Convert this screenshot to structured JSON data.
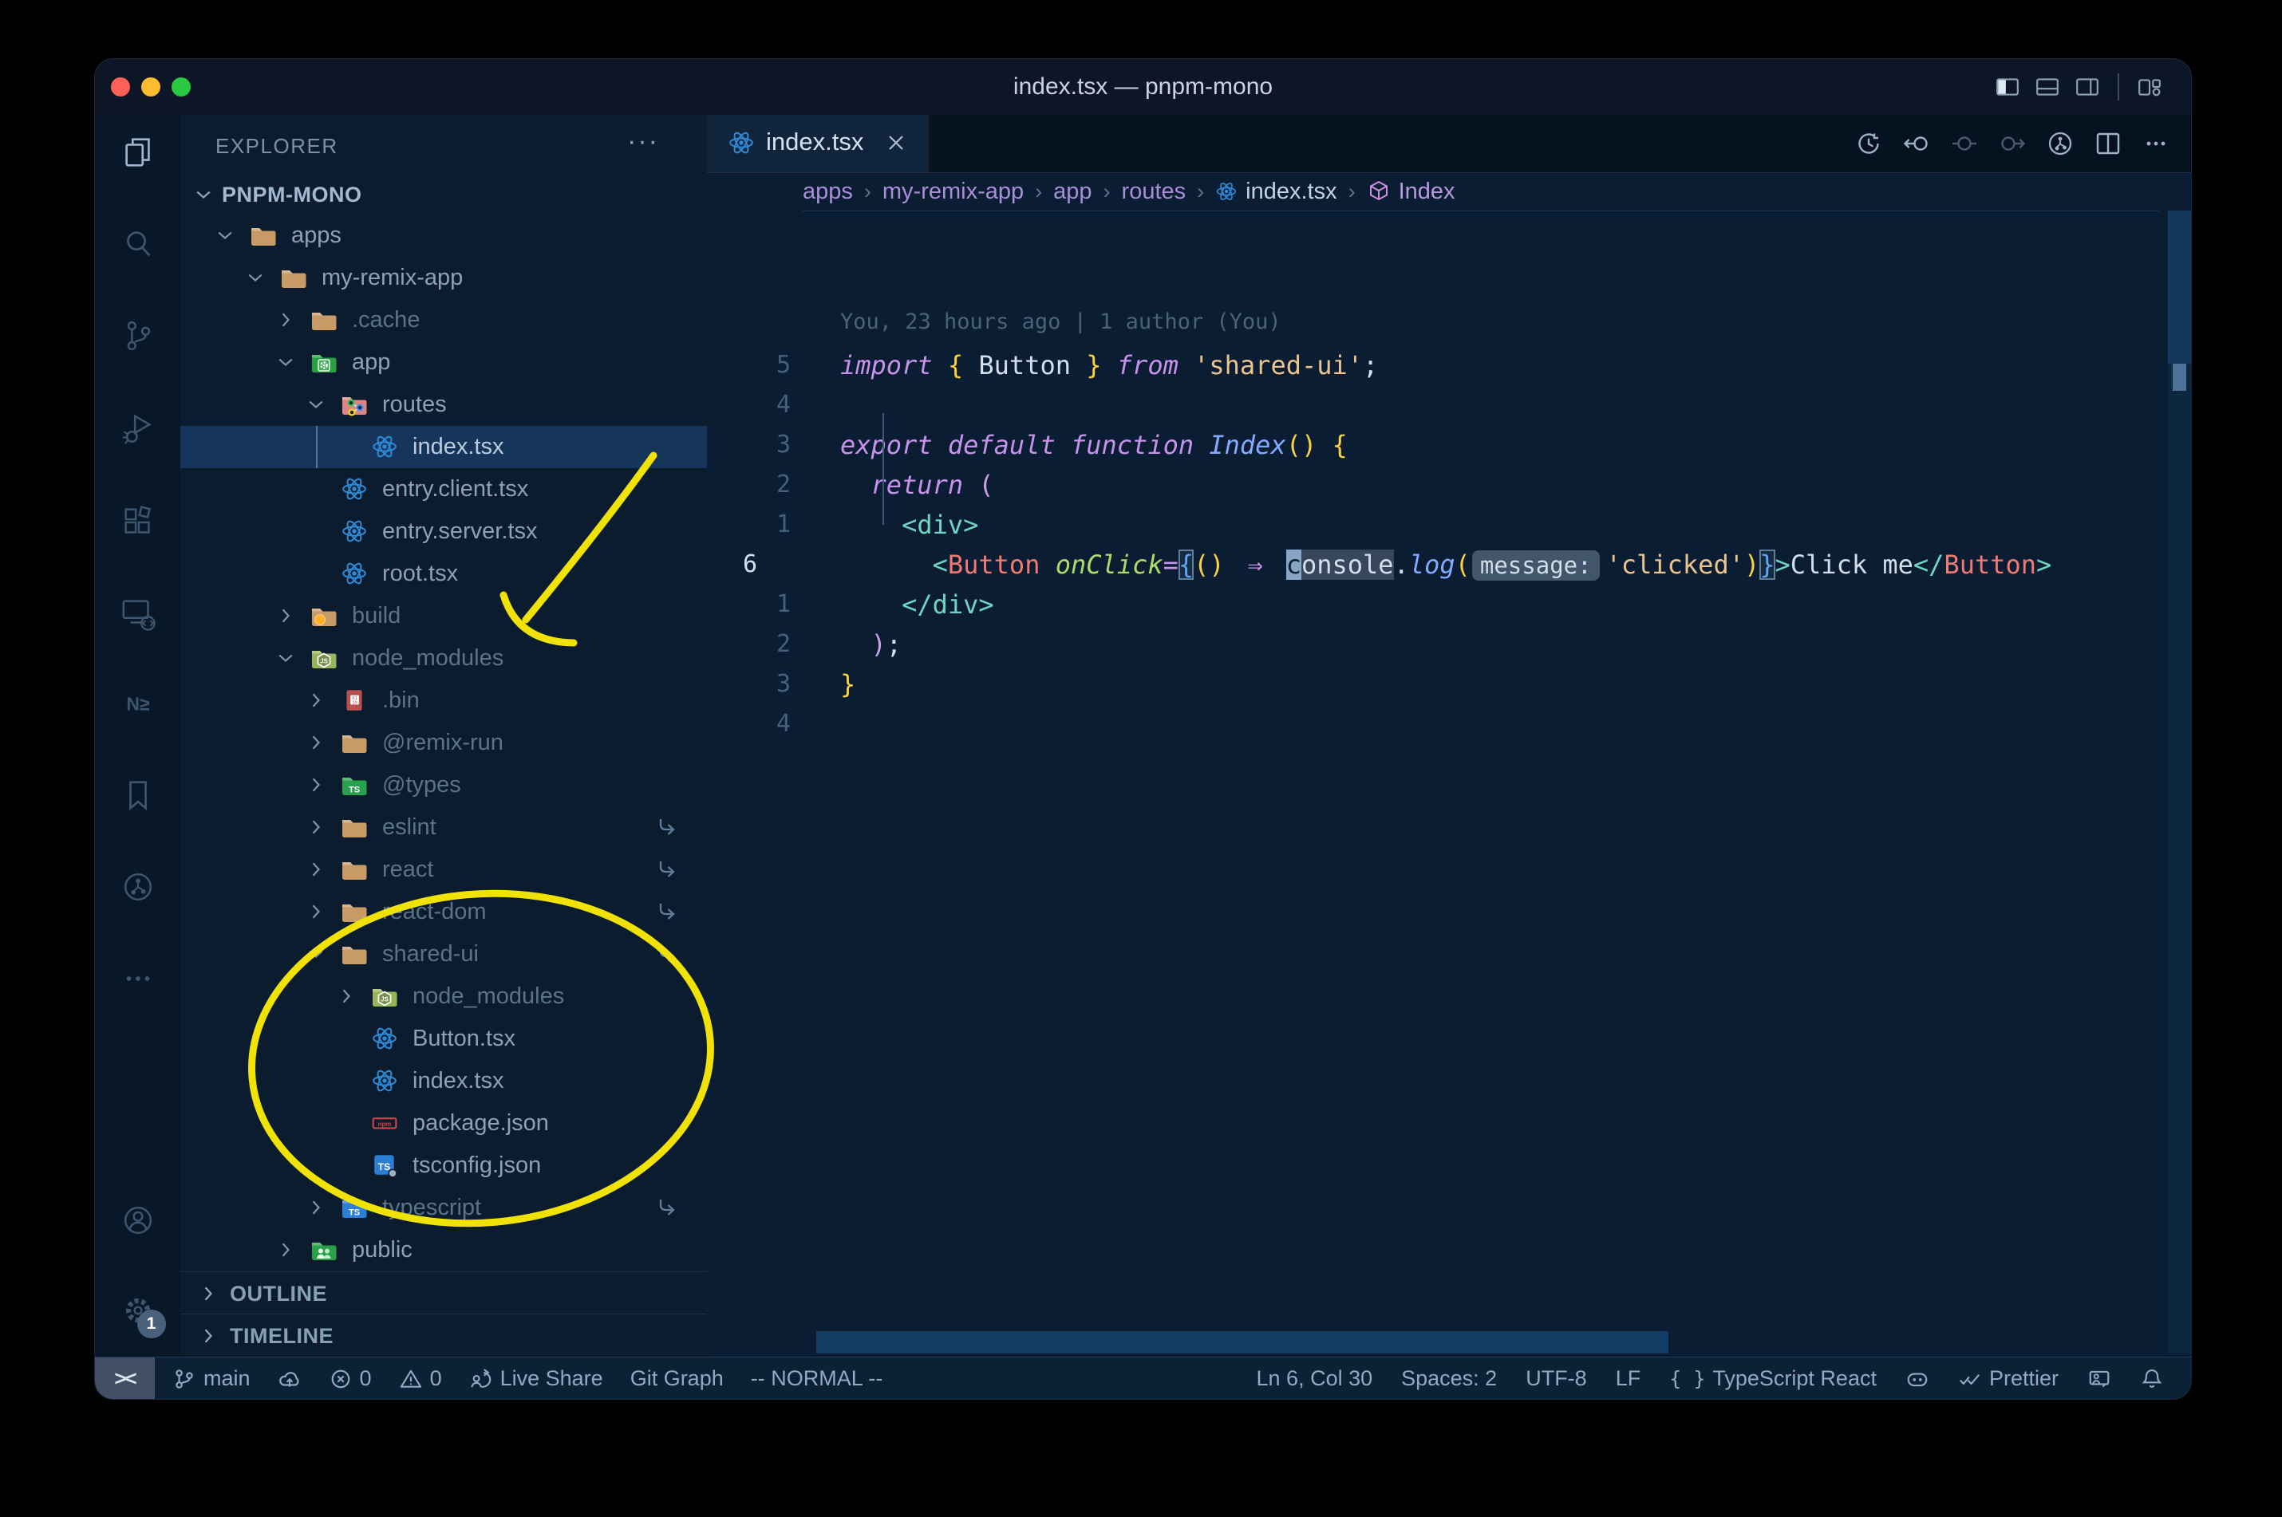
{
  "window": {
    "title": "index.tsx — pnpm-mono"
  },
  "colors": {
    "accent": "#2d8ad6",
    "selection": "#16355a",
    "annotation": "#f0e204"
  },
  "titlebar_actions": [
    {
      "id": "toggle-primary-sidebar"
    },
    {
      "id": "toggle-panel"
    },
    {
      "id": "toggle-secondary-sidebar"
    },
    {
      "id": "customize-layout"
    }
  ],
  "activity_bar": {
    "items": [
      {
        "id": "explorer",
        "active": true
      },
      {
        "id": "search"
      },
      {
        "id": "source-control"
      },
      {
        "id": "run-debug"
      },
      {
        "id": "extensions"
      },
      {
        "id": "remote-explorer"
      },
      {
        "id": "nx-console"
      },
      {
        "id": "bookmarks"
      },
      {
        "id": "git-graph"
      },
      {
        "id": "more"
      },
      {
        "id": "account"
      },
      {
        "id": "settings",
        "badge": "1"
      }
    ]
  },
  "sidebar": {
    "header": "EXPLORER",
    "header_menu": "···",
    "project": "PNPM-MONO",
    "tree": [
      {
        "label": "apps",
        "depth": 1,
        "icon": "folder",
        "state": "open"
      },
      {
        "label": "my-remix-app",
        "depth": 2,
        "icon": "folder",
        "state": "open"
      },
      {
        "label": ".cache",
        "depth": 3,
        "icon": "folder",
        "state": "closed",
        "dim": true
      },
      {
        "label": "app",
        "depth": 3,
        "icon": "folder-app",
        "state": "open"
      },
      {
        "label": "routes",
        "depth": 4,
        "icon": "folder-routes",
        "state": "open"
      },
      {
        "label": "index.tsx",
        "depth": 5,
        "icon": "react",
        "state": "file",
        "selected": true
      },
      {
        "label": "entry.client.tsx",
        "depth": 4,
        "icon": "react",
        "state": "file"
      },
      {
        "label": "entry.server.tsx",
        "depth": 4,
        "icon": "react",
        "state": "file"
      },
      {
        "label": "root.tsx",
        "depth": 4,
        "icon": "react",
        "state": "file"
      },
      {
        "label": "build",
        "depth": 3,
        "icon": "folder-build",
        "state": "closed",
        "dim": true
      },
      {
        "label": "node_modules",
        "depth": 3,
        "icon": "folder-nm",
        "state": "open",
        "dim": true
      },
      {
        "label": ".bin",
        "depth": 4,
        "icon": "file-bin",
        "state": "closed",
        "dim": true
      },
      {
        "label": "@remix-run",
        "depth": 4,
        "icon": "folder",
        "state": "closed",
        "dim": true
      },
      {
        "label": "@types",
        "depth": 4,
        "icon": "folder-ts-green",
        "state": "closed",
        "dim": true
      },
      {
        "label": "eslint",
        "depth": 4,
        "icon": "folder",
        "state": "closed",
        "dim": true,
        "symlink": true
      },
      {
        "label": "react",
        "depth": 4,
        "icon": "folder",
        "state": "closed",
        "dim": true,
        "symlink": true
      },
      {
        "label": "react-dom",
        "depth": 4,
        "icon": "folder",
        "state": "closed",
        "dim": true,
        "symlink": true
      },
      {
        "label": "shared-ui",
        "depth": 4,
        "icon": "folder",
        "state": "open",
        "dim": true,
        "symlink": true
      },
      {
        "label": "node_modules",
        "depth": 5,
        "icon": "folder-nm",
        "state": "closed",
        "dim": true
      },
      {
        "label": "Button.tsx",
        "depth": 5,
        "icon": "react",
        "state": "file"
      },
      {
        "label": "index.tsx",
        "depth": 5,
        "icon": "react",
        "state": "file"
      },
      {
        "label": "package.json",
        "depth": 5,
        "icon": "npm",
        "state": "file"
      },
      {
        "label": "tsconfig.json",
        "depth": 5,
        "icon": "tsconfig",
        "state": "file"
      },
      {
        "label": "typescript",
        "depth": 4,
        "icon": "folder-ts-blue",
        "state": "closed",
        "dim": true,
        "symlink": true
      },
      {
        "label": "public",
        "depth": 3,
        "icon": "folder-public",
        "state": "closed"
      }
    ],
    "sections": [
      {
        "label": "OUTLINE"
      },
      {
        "label": "TIMELINE"
      }
    ]
  },
  "editor": {
    "tab": {
      "label": "index.tsx",
      "icon": "react"
    },
    "actions": [
      {
        "id": "timeline-history"
      },
      {
        "id": "previous-change"
      },
      {
        "id": "open-changes",
        "dim": true
      },
      {
        "id": "next-change",
        "dim": true
      },
      {
        "id": "git-graph"
      },
      {
        "id": "split-editor"
      },
      {
        "id": "more-actions"
      }
    ],
    "breadcrumbs": [
      {
        "label": "apps"
      },
      {
        "label": "my-remix-app"
      },
      {
        "label": "app"
      },
      {
        "label": "routes"
      },
      {
        "label": "index.tsx",
        "icon": "react",
        "tone": "file"
      },
      {
        "label": "Index",
        "icon": "symbol-class",
        "tone": "symbol"
      }
    ],
    "blame": "You, 23 hours ago | 1 author (You)",
    "lines": [
      {
        "num": "5",
        "tokens": [
          {
            "t": "import",
            "c": "kw"
          },
          {
            "t": " "
          },
          {
            "t": "{",
            "c": "gold"
          },
          {
            "t": " Button "
          },
          {
            "t": "}",
            "c": "gold"
          },
          {
            "t": " "
          },
          {
            "t": "from",
            "c": "kw"
          },
          {
            "t": " "
          },
          {
            "t": "'shared-ui'",
            "c": "str"
          },
          {
            "t": ";"
          }
        ]
      },
      {
        "num": "4",
        "tokens": []
      },
      {
        "num": "3",
        "tokens": [
          {
            "t": "export",
            "c": "kw"
          },
          {
            "t": " "
          },
          {
            "t": "default",
            "c": "kw"
          },
          {
            "t": " "
          },
          {
            "t": "function",
            "c": "kw"
          },
          {
            "t": " "
          },
          {
            "t": "Index",
            "c": "fn"
          },
          {
            "t": "()",
            "c": "gold"
          },
          {
            "t": " "
          },
          {
            "t": "{",
            "c": "gold"
          }
        ]
      },
      {
        "num": "2",
        "tokens": [
          {
            "t": "  "
          },
          {
            "t": "return",
            "c": "kw"
          },
          {
            "t": " "
          },
          {
            "t": "(",
            "c": "pink"
          }
        ]
      },
      {
        "num": "1",
        "tokens": [
          {
            "t": "    "
          },
          {
            "t": "<div>",
            "c": "teal"
          }
        ]
      },
      {
        "num": "6",
        "current": true,
        "tokens": [
          {
            "t": "      "
          },
          {
            "t": "<",
            "c": "teal"
          },
          {
            "t": "Button",
            "c": "comp"
          },
          {
            "t": " "
          },
          {
            "t": "onClick",
            "c": "attr"
          },
          {
            "t": "=",
            "c": "kw"
          },
          {
            "t": "{",
            "c": "blue",
            "match": true
          },
          {
            "t": "()",
            "c": "gold"
          },
          {
            "t": " "
          },
          {
            "t": "⇒",
            "c": "kw",
            "wide": true
          },
          {
            "t": " "
          },
          {
            "t": "c",
            "c": "cursor"
          },
          {
            "t": "onsole",
            "c": "hl"
          },
          {
            "t": "."
          },
          {
            "t": "log",
            "c": "fn"
          },
          {
            "t": "(",
            "c": "gold"
          },
          {
            "t": "message:",
            "c": "hint"
          },
          {
            "t": "'clicked'",
            "c": "str"
          },
          {
            "t": ")",
            "c": "gold"
          },
          {
            "t": "}",
            "c": "blue",
            "match": true
          },
          {
            "t": ">",
            "c": "teal"
          },
          {
            "t": "Click me"
          },
          {
            "t": "</",
            "c": "teal"
          },
          {
            "t": "Button",
            "c": "comp"
          },
          {
            "t": ">",
            "c": "teal"
          }
        ]
      },
      {
        "num": "1",
        "tokens": [
          {
            "t": "    "
          },
          {
            "t": "</div>",
            "c": "teal"
          }
        ]
      },
      {
        "num": "2",
        "tokens": [
          {
            "t": "  "
          },
          {
            "t": ")",
            "c": "pink"
          },
          {
            "t": ";"
          }
        ]
      },
      {
        "num": "3",
        "tokens": [
          {
            "t": "}",
            "c": "gold"
          }
        ]
      },
      {
        "num": "4",
        "tokens": []
      }
    ]
  },
  "status_bar": {
    "remote": "><",
    "left": [
      {
        "icon": "branch",
        "label": "main"
      },
      {
        "icon": "cloud-upload"
      },
      {
        "icon": "error",
        "label": "0"
      },
      {
        "icon": "warning",
        "label": "0"
      },
      {
        "icon": "live-share",
        "label": "Live Share"
      },
      {
        "label": "Git Graph"
      },
      {
        "label": "-- NORMAL --"
      }
    ],
    "right": [
      {
        "label": "Ln 6, Col 30"
      },
      {
        "label": "Spaces: 2"
      },
      {
        "label": "UTF-8"
      },
      {
        "label": "LF"
      },
      {
        "icon": "braces",
        "label": "TypeScript React"
      },
      {
        "icon": "copilot"
      },
      {
        "icon": "prettier",
        "label": "Prettier"
      },
      {
        "icon": "feedback"
      },
      {
        "icon": "bell"
      }
    ]
  }
}
